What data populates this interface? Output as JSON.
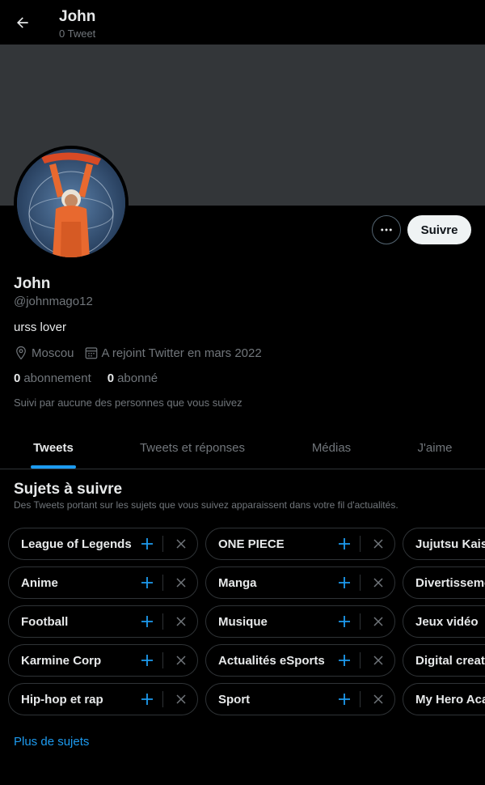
{
  "header": {
    "name": "John",
    "tweet_count": "0 Tweet"
  },
  "profile": {
    "name": "John",
    "handle": "@johnmago12",
    "bio": "urss lover",
    "location": "Moscou",
    "joined": "A rejoint Twitter en mars 2022",
    "following_count": "0",
    "following_label": "abonnement",
    "followers_count": "0",
    "followers_label": "abonné",
    "followed_by": "Suivi par aucune des personnes que vous suivez",
    "follow_button": "Suivre"
  },
  "tabs": [
    {
      "label": "Tweets",
      "active": true
    },
    {
      "label": "Tweets et réponses",
      "active": false
    },
    {
      "label": "Médias",
      "active": false
    },
    {
      "label": "J'aime",
      "active": false
    }
  ],
  "topics": {
    "title": "Sujets à suivre",
    "subtitle": "Des Tweets portant sur les sujets que vous suivez apparaissent dans votre fil d'actualités.",
    "columns": [
      [
        "League of Legends",
        "Anime",
        "Football",
        "Karmine Corp",
        "Hip-hop et rap"
      ],
      [
        "ONE PIECE",
        "Manga",
        "Musique",
        "Actualités eSports",
        "Sport"
      ],
      [
        "Jujutsu Kaisen",
        "Divertissement",
        "Jeux vidéo",
        "Digital creators",
        "My Hero Academia"
      ]
    ],
    "more_link": "Plus de sujets"
  },
  "colors": {
    "background": "#000000",
    "banner": "#333639",
    "accent": "#1d9bf0",
    "muted_text": "#71767b",
    "border": "#2f3336"
  },
  "icons": {
    "back": "arrow-left-icon",
    "more": "more-dots-icon",
    "location": "location-pin-icon",
    "calendar": "calendar-icon",
    "add": "plus-icon",
    "dismiss": "close-icon"
  }
}
